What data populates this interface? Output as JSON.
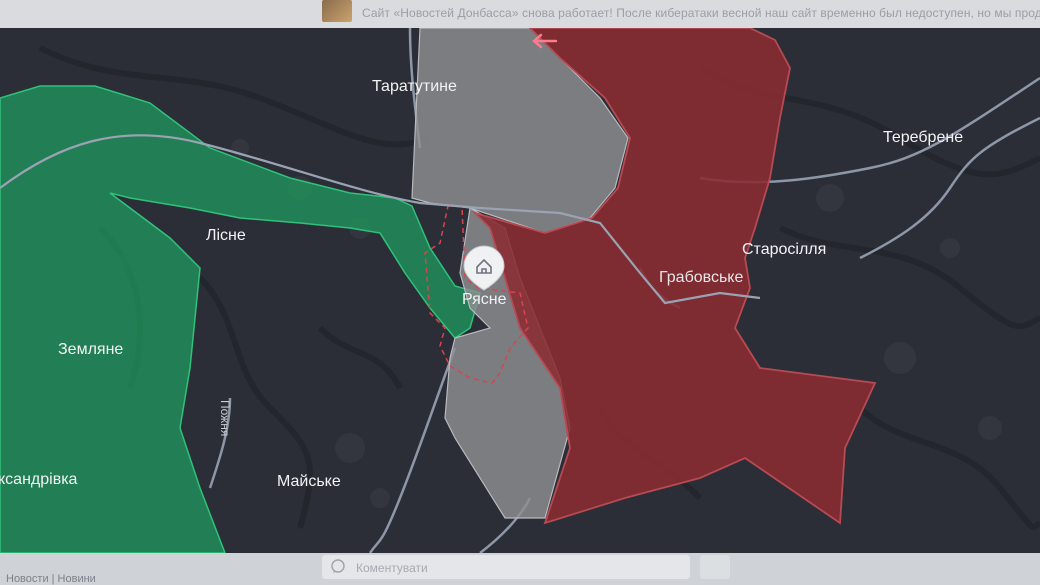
{
  "news_ticker": {
    "text": "Сайт «Новостей Донбасса» снова работает! После кибератаки весной наш сайт временно был недоступен, но мы продолжа"
  },
  "map": {
    "colors": {
      "background": "#2b2e36",
      "road": "#9aa3b3",
      "green_zone": "#1f9e5f",
      "red_zone": "#8a2b31",
      "grey_zone": "#8f8f93",
      "label": "#f2f3f5"
    },
    "labels": {
      "taratutyne": "Таратутине",
      "terebrene": "Теребрене",
      "lisne": "Лісне",
      "starosillia": "Старосілля",
      "grabovske": "Грабовське",
      "riasne": "Рясне",
      "zemliane": "Землянe",
      "oleksandrivka": "ксандрівка",
      "maiske": "Майське",
      "pozhnia": "Пожня"
    },
    "marker": {
      "icon": "home-icon"
    },
    "arrow": {
      "icon": "arrow-left-icon"
    }
  },
  "bottom_bar": {
    "left_text": "Новости | Новини",
    "comment_placeholder": "Коментувати"
  }
}
